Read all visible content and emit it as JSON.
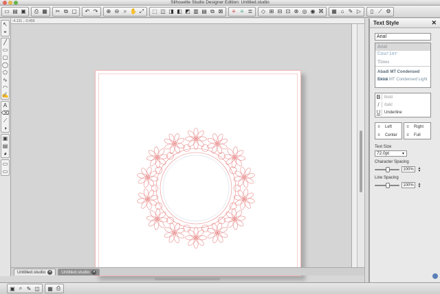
{
  "window": {
    "title": "Silhouette Studio Designer Edition: Untitled.studio"
  },
  "ruler": {
    "coords": "-4.131 , -0.455"
  },
  "tabs": [
    {
      "label": "Untitled.studio",
      "active": true
    },
    {
      "label": "Untitled.studio",
      "active": false
    }
  ],
  "text_style_panel": {
    "title": "Text Style",
    "close_glyph": "✕",
    "font_input_value": "Arial",
    "font_list": [
      "Arial",
      "Courier",
      "Times",
      "Abadi MT Condensed Extra",
      "Abadi MT Condensed Light"
    ],
    "styles": [
      {
        "icon": "B",
        "label": "Bold"
      },
      {
        "icon": "/",
        "label": "Italic"
      },
      {
        "icon": "U",
        "label": "Underline"
      }
    ],
    "align_left": [
      {
        "icon": "≡",
        "label": "Left"
      },
      {
        "icon": "≡",
        "label": "Center"
      }
    ],
    "align_right": [
      {
        "icon": "≡",
        "label": "Right"
      },
      {
        "icon": "≡",
        "label": "Full"
      }
    ],
    "text_size_label": "Text Size",
    "text_size_value": "72.0pt",
    "character_spacing_label": "Character Spacing",
    "character_spacing_value": "100%",
    "line_spacing_label": "Line Spacing",
    "line_spacing_value": "100%"
  },
  "colors": {
    "lace_stroke": "#e88a8a",
    "page_border": "#f1b5b5",
    "canvas": "#d5d5d5"
  }
}
